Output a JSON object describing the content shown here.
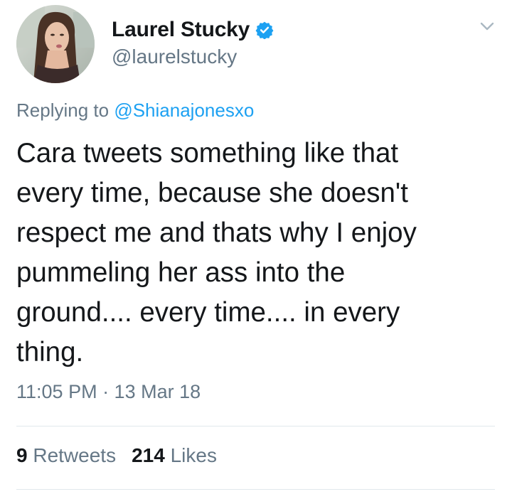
{
  "tweet": {
    "author": {
      "display_name": "Laurel Stucky",
      "handle": "@laurelstucky",
      "verified": true,
      "avatar_icon": "profile-photo"
    },
    "reply": {
      "prefix": "Replying to",
      "mention": "@Shianajonesxo"
    },
    "text_lines": [
      "Cara tweets something like that",
      "every time, because she doesn't",
      "respect me and thats why I enjoy",
      "pummeling her ass into the",
      "ground.... every time.... in every",
      "thing."
    ],
    "timestamp": "11:05 PM · 13 Mar 18",
    "stats": {
      "retweets_count": "9",
      "retweets_label": "Retweets",
      "likes_count": "214",
      "likes_label": "Likes"
    },
    "menu_icon": "chevron-down-icon"
  },
  "colors": {
    "text_primary": "#14171a",
    "text_secondary": "#657786",
    "link": "#1da1f2",
    "divider": "#e1e8ed",
    "verified": "#1da1f2"
  }
}
